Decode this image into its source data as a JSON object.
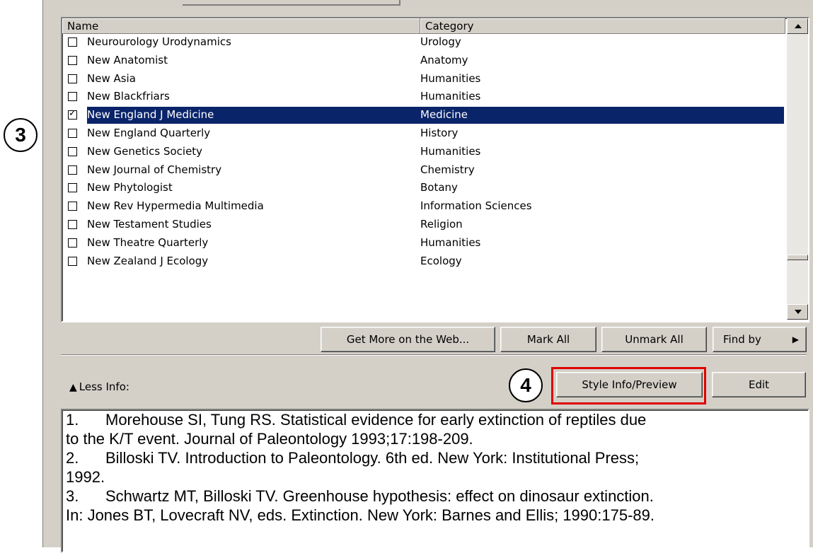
{
  "list": {
    "columns": [
      "Name",
      "Category"
    ],
    "rows": [
      {
        "name": "Neurourology Urodynamics",
        "category": "Urology",
        "checked": false
      },
      {
        "name": "New Anatomist",
        "category": "Anatomy",
        "checked": false
      },
      {
        "name": "New Asia",
        "category": "Humanities",
        "checked": false
      },
      {
        "name": "New Blackfriars",
        "category": "Humanities",
        "checked": false
      },
      {
        "name": "New England J Medicine",
        "category": "Medicine",
        "checked": true
      },
      {
        "name": "New England Quarterly",
        "category": "History",
        "checked": false
      },
      {
        "name": "New Genetics Society",
        "category": "Humanities",
        "checked": false
      },
      {
        "name": "New Journal of Chemistry",
        "category": "Chemistry",
        "checked": false
      },
      {
        "name": "New Phytologist",
        "category": "Botany",
        "checked": false
      },
      {
        "name": "New Rev Hypermedia Multimedia",
        "category": "Information Sciences",
        "checked": false
      },
      {
        "name": "New Testament Studies",
        "category": "Religion",
        "checked": false
      },
      {
        "name": "New Theatre Quarterly",
        "category": "Humanities",
        "checked": false
      },
      {
        "name": "New Zealand J Ecology",
        "category": "Ecology",
        "checked": false
      }
    ],
    "selected_index": 4
  },
  "buttons": {
    "get_more": "Get More on the Web...",
    "mark_all": "Mark All",
    "unmark_all": "Unmark All",
    "find_by": "Find by",
    "style_info": "Style Info/Preview",
    "edit": "Edit"
  },
  "less_info_label": "Less Info:",
  "callouts": {
    "step3": "3",
    "step4": "4"
  },
  "preview": [
    {
      "num": "1.",
      "text": "Morehouse SI, Tung RS. Statistical evidence for early extinction of reptiles due"
    },
    {
      "num": "",
      "text": "to the K/T event. Journal of Paleontology 1993;17:198-209."
    },
    {
      "num": "2.",
      "text": "Billoski TV. Introduction to Paleontology. 6th ed. New York: Institutional Press;"
    },
    {
      "num": "",
      "text": "1992."
    },
    {
      "num": "3.",
      "text": "Schwartz MT, Billoski TV. Greenhouse hypothesis: effect on dinosaur extinction."
    },
    {
      "num": "",
      "text": "In: Jones BT, Lovecraft NV, eds. Extinction. New York: Barnes and Ellis; 1990:175-89."
    }
  ],
  "colors": {
    "selection": "#0a246a",
    "highlight_border": "#e00000",
    "dialog_bg": "#d4d0c8"
  }
}
